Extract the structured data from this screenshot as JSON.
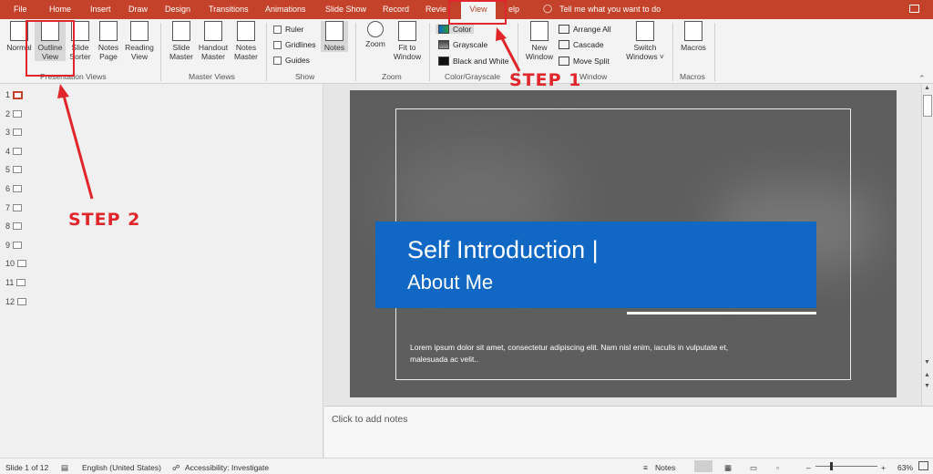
{
  "tabs": {
    "file": "File",
    "home": "Home",
    "insert": "Insert",
    "draw": "Draw",
    "design": "Design",
    "transitions": "Transitions",
    "animations": "Animations",
    "slide_show": "Slide Show",
    "record": "Record",
    "review": "Revie",
    "view": "View",
    "help": "elp",
    "tell_me": "Tell me what you want to do"
  },
  "ribbon": {
    "presentation_views": {
      "label": "Presentation Views",
      "normal": "Normal",
      "outline_1": "Outline",
      "outline_2": "View",
      "sorter_1": "Slide",
      "sorter_2": "Sorter",
      "notes_page_1": "Notes",
      "notes_page_2": "Page",
      "reading_1": "Reading",
      "reading_2": "View"
    },
    "master_views": {
      "label": "Master Views",
      "slide_1": "Slide",
      "slide_2": "Master",
      "handout_1": "Handout",
      "handout_2": "Master",
      "notes_1": "Notes",
      "notes_2": "Master"
    },
    "show": {
      "label": "Show",
      "ruler": "Ruler",
      "gridlines": "Gridlines",
      "guides": "Guides",
      "notes": "Notes"
    },
    "zoom": {
      "label": "Zoom",
      "zoom": "Zoom",
      "fit_1": "Fit to",
      "fit_2": "Window"
    },
    "color": {
      "label": "Color/Grayscale",
      "color": "Color",
      "grayscale": "Grayscale",
      "bw": "Black and White"
    },
    "window": {
      "label": "Window",
      "new_1": "New",
      "new_2": "Window",
      "arrange_all": "Arrange All",
      "cascade": "Cascade",
      "move_split": "Move Split",
      "switch_1": "Switch",
      "switch_2": "Windows ˅"
    },
    "macros": {
      "label": "Macros",
      "macros": "Macros"
    }
  },
  "slide_numbers": [
    "1",
    "2",
    "3",
    "4",
    "5",
    "6",
    "7",
    "8",
    "9",
    "10",
    "11",
    "12"
  ],
  "slide": {
    "title_line1": "Self Introduction |",
    "title_line2": "About Me",
    "body": "Lorem ipsum dolor sit amet, consectetur adipiscing elit. Nam nisl enim, iaculis in vulputate et, malesuada ac velit.."
  },
  "notes_placeholder": "Click to add notes",
  "status": {
    "slide_count": "Slide 1 of 12",
    "language": "English (United States)",
    "accessibility": "Accessibility: Investigate",
    "notes": "Notes",
    "zoom": "63%",
    "minus": "–",
    "plus": "+"
  },
  "annotations": {
    "step1": "STEP 1",
    "step2": "STEP 2"
  },
  "colors": {
    "accent": "#c4422a",
    "title_band": "#1068c4",
    "annotation": "#e0262a"
  }
}
